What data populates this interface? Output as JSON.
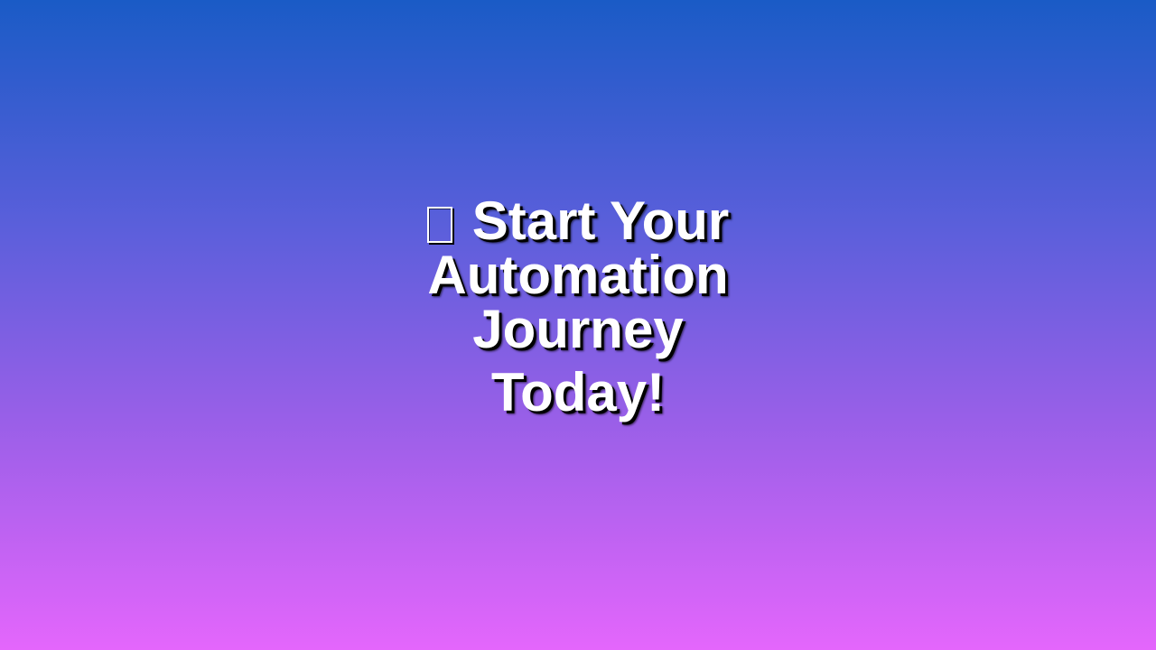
{
  "hero": {
    "icon": "rocket-icon",
    "line1": "Start Your",
    "line2": "Automation Journey",
    "line3": "Today!"
  }
}
